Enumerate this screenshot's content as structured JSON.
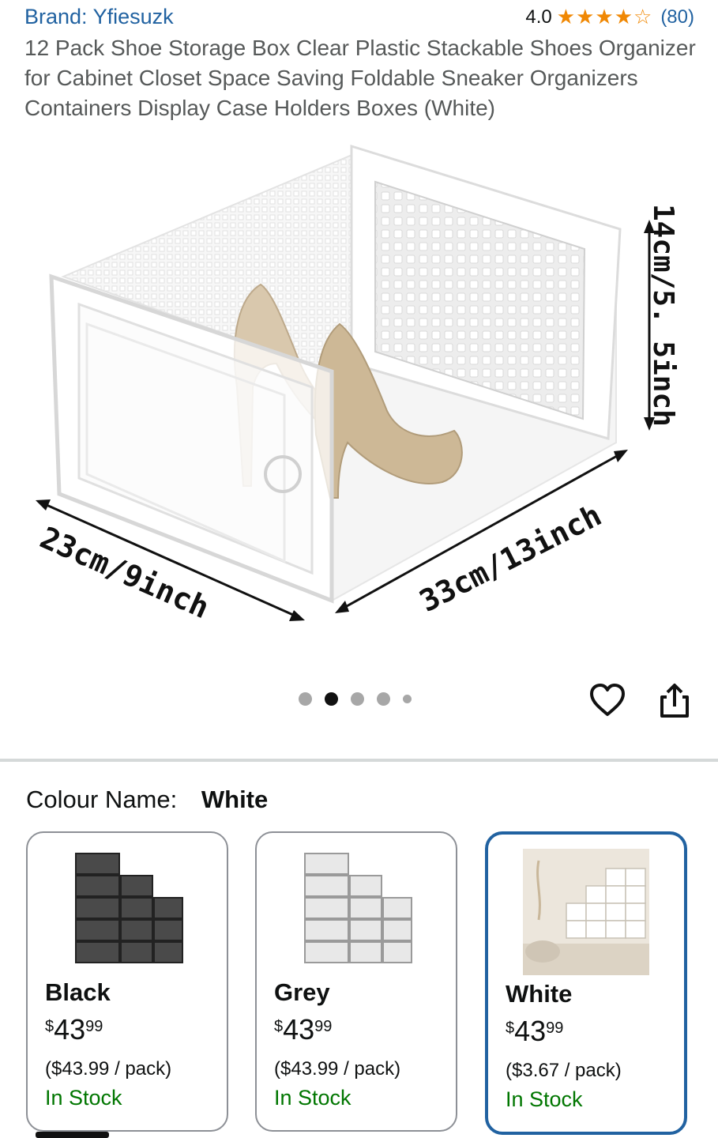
{
  "header": {
    "brand": "Brand: Yfiesuzk",
    "rating_score": "4.0",
    "rating_stars": "★★★★☆",
    "rating_count": "(80)",
    "stars_icon": "star-icon",
    "rating_value": 4.0
  },
  "product": {
    "title": "12 Pack Shoe Storage Box Clear Plastic Stackable Shoes Organizer for Cabinet Closet Space Saving Foldable Sneaker Organizers Containers Display Case Holders Boxes (White)"
  },
  "hero": {
    "dim_height": "14cm/5. 5inch",
    "dim_width": "23cm/9inch",
    "dim_depth": "33cm/13inch"
  },
  "carousel": {
    "total": 5,
    "active_index": 1
  },
  "actions": {
    "favorite_icon": "heart-icon",
    "share_icon": "share-icon"
  },
  "colour": {
    "label": "Colour Name:",
    "selected": "White",
    "options": [
      {
        "name": "Black",
        "price_symbol": "$",
        "price_whole": "43",
        "price_fraction": "99",
        "unit_price": "($43.99 / pack)",
        "availability": "In Stock"
      },
      {
        "name": "Grey",
        "price_symbol": "$",
        "price_whole": "43",
        "price_fraction": "99",
        "unit_price": "($43.99 / pack)",
        "availability": "In Stock"
      },
      {
        "name": "White",
        "price_symbol": "$",
        "price_whole": "43",
        "price_fraction": "99",
        "unit_price": "($3.67 / pack)",
        "availability": "In Stock"
      }
    ]
  },
  "colors": {
    "link": "#2162a1",
    "star": "#f08804",
    "in_stock": "#007600",
    "selected_border": "#2162a1",
    "muted_text": "#565959"
  }
}
